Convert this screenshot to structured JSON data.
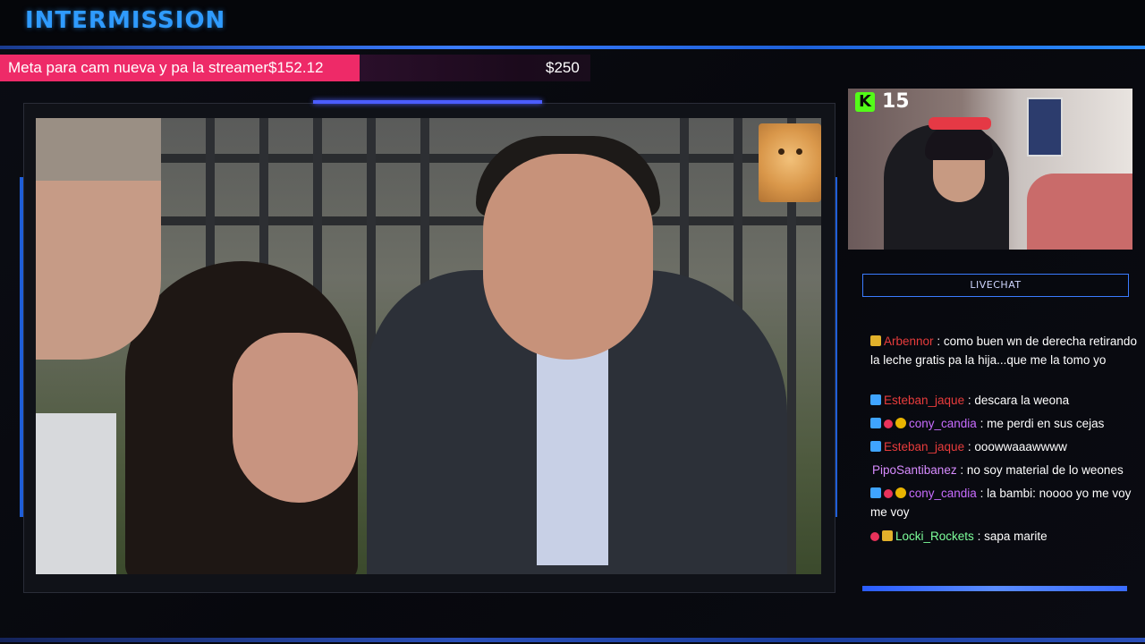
{
  "header": {
    "title": "INTERMISSION"
  },
  "goal": {
    "label": "Meta para cam nueva y pa la streamer$152.12",
    "target": "$250",
    "progress": 0.61,
    "color": "#ee2a68"
  },
  "webcam": {
    "platform_badge": "K",
    "viewer_count": "15"
  },
  "chat": {
    "title": "LIVECHAT",
    "messages": [
      {
        "user": "Arbennor",
        "text": ": como buen wn de derecha retirando la leche gratis pa la hija...que me la tomo yo"
      },
      {
        "user": "Esteban_jaque",
        "text": ": descara la weona"
      },
      {
        "user": "cony_candia",
        "text": ": me perdi en sus cejas"
      },
      {
        "user": "Esteban_jaque",
        "text": ": ooowwaaawwww"
      },
      {
        "user": "PipoSantibanez",
        "text": ": no soy material de lo weones"
      },
      {
        "user": "cony_candia",
        "text": ": la bambi: noooo yo me voy me voy"
      },
      {
        "user": "Locki_Rockets",
        "text": ": sapa marite"
      }
    ]
  },
  "colors": {
    "accent": "#2f9bff",
    "frame_blue": "#1f5ed8",
    "kick_green": "#53fc18"
  }
}
